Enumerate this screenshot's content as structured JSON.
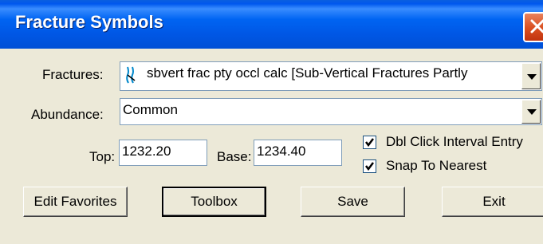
{
  "window": {
    "title": "Fracture Symbols"
  },
  "fractures": {
    "label": "Fractures:",
    "value": "sbvert frac pty occl calc [Sub-Vertical Fractures Partly",
    "icon": "fracture-symbol-icon"
  },
  "abundance": {
    "label": "Abundance:",
    "value": "Common"
  },
  "interval": {
    "top_label": "Top:",
    "top_value": "1232.20",
    "base_label": "Base:",
    "base_value": "1234.40"
  },
  "options": {
    "dbl_click_label": "Dbl Click Interval Entry",
    "dbl_click_checked": true,
    "snap_label": "Snap To Nearest",
    "snap_checked": true
  },
  "buttons": {
    "edit_favorites": "Edit Favorites",
    "toolbox": "Toolbox",
    "save": "Save",
    "exit": "Exit"
  }
}
